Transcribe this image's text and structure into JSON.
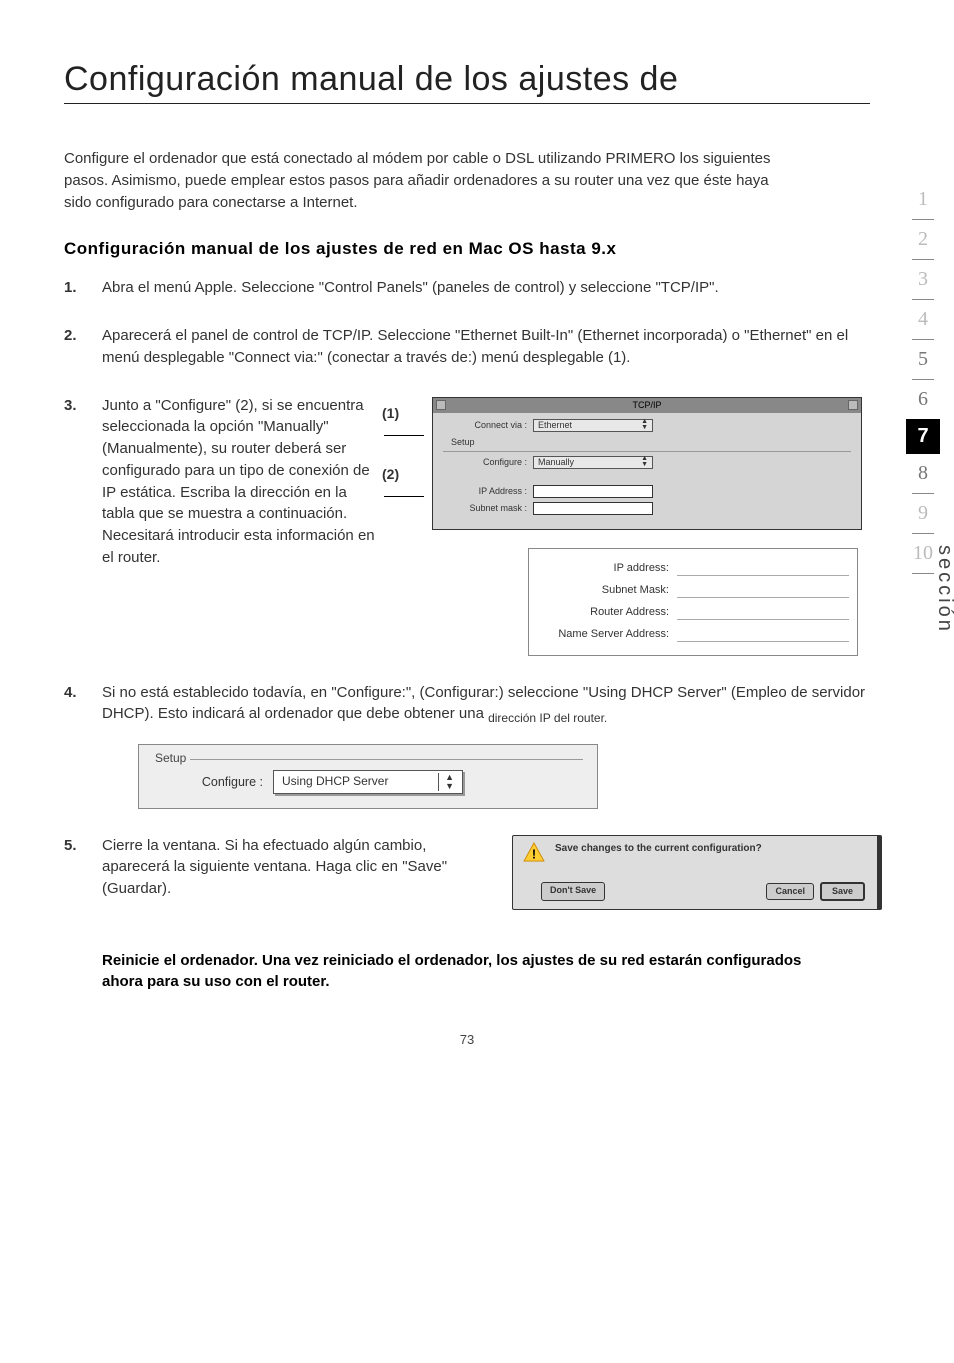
{
  "title": "Configuración manual de los ajustes de",
  "intro": "Configure el ordenador que está conectado al módem por cable o DSL utilizando PRIMERO los siguientes pasos. Asimismo, puede emplear estos pasos para añadir ordenadores a su router una vez que éste haya sido configurado para conectarse a Internet.",
  "subhead": "Configuración manual de los ajustes de red en Mac OS hasta 9.x",
  "steps": {
    "s1": {
      "num": "1.",
      "text": "Abra el menú Apple. Seleccione \"Control Panels\" (paneles de control) y seleccione \"TCP/IP\"."
    },
    "s2": {
      "num": "2.",
      "text": "Aparecerá el panel de control de TCP/IP. Seleccione \"Ethernet Built-In\" (Ethernet incorporada) o \"Ethernet\" en el menú desplegable \"Connect via:\" (conectar a través de:) menú desplegable (1)."
    },
    "s3": {
      "num": "3.",
      "text": "Junto a \"Configure\" (2), si se encuentra seleccionada la opción \"Manually\" (Manualmente), su router deberá ser configurado para un tipo de conexión de IP estática. Escriba la dirección en la tabla que se muestra a continuación. Necesitará introducir esta información en el router."
    },
    "s4": {
      "num": "4.",
      "text_a": "Si no está establecido todavía, en \"Configure:\", (Configurar:) seleccione \"Using DHCP Server\" (Empleo de servidor DHCP). Esto indicará al ordenador que debe obtener una ",
      "text_b": "dirección IP del router."
    },
    "s5": {
      "num": "5.",
      "text": "Cierre la ventana. Si ha efectuado algún cambio, aparecerá la siguiente ventana. Haga clic en \"Save\" (Guardar)."
    }
  },
  "callouts": {
    "c1": "(1)",
    "c2": "(2)"
  },
  "tcpip": {
    "title": "TCP/IP",
    "connect_via_label": "Connect via :",
    "connect_via_value": "Ethernet",
    "setup_label": "Setup",
    "configure_label": "Configure :",
    "configure_value": "Manually",
    "ip_label": "IP Address :",
    "subnet_label": "Subnet mask :"
  },
  "addr": {
    "ip": "IP address:",
    "subnet": "Subnet Mask:",
    "router": "Router Address:",
    "ns": "Name Server Address:"
  },
  "setup": {
    "legend": "Setup",
    "configure_label": "Configure :",
    "dropdown_value": "Using DHCP Server"
  },
  "savedlg": {
    "msg": "Save changes to the current configuration?",
    "dont_save": "Don't Save",
    "cancel": "Cancel",
    "save": "Save"
  },
  "footer_bold": "Reinicie el ordenador. Una vez reiniciado el ordenador, los ajustes de su red estarán configurados ahora para su uso con el router.",
  "pagenum": "73",
  "sidenav": {
    "n1": "1",
    "n2": "2",
    "n3": "3",
    "n4": "4",
    "n5": "5",
    "n6": "6",
    "n7": "7",
    "n8": "8",
    "n9": "9",
    "n10": "10"
  },
  "seccion_label": "sección"
}
